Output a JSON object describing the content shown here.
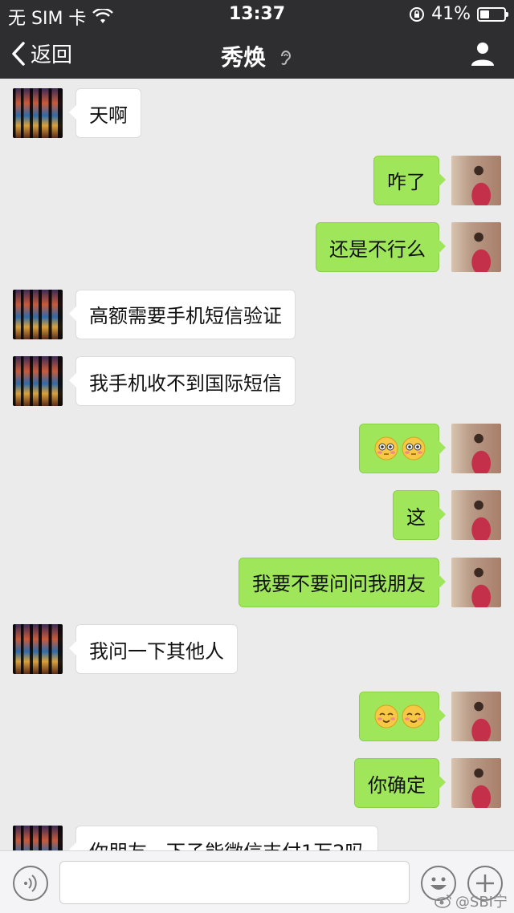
{
  "status_bar": {
    "carrier": "无 SIM 卡",
    "time": "13:37",
    "battery": "41%",
    "battery_level": 0.41
  },
  "nav": {
    "back_label": "返回",
    "title": "秀焕"
  },
  "messages": [
    {
      "side": "left",
      "text": "天啊"
    },
    {
      "side": "right",
      "text": "咋了"
    },
    {
      "side": "right",
      "text": "还是不行么"
    },
    {
      "side": "left",
      "text": "高额需要手机短信验证"
    },
    {
      "side": "left",
      "text": "我手机收不到国际短信"
    },
    {
      "side": "right",
      "text": "",
      "emoji": [
        "flushed-face",
        "flushed-face"
      ]
    },
    {
      "side": "right",
      "text": "这"
    },
    {
      "side": "right",
      "text": "我要不要问问我朋友"
    },
    {
      "side": "left",
      "text": "我问一下其他人"
    },
    {
      "side": "right",
      "text": "",
      "emoji": [
        "smiling-blush-face",
        "smiling-blush-face"
      ]
    },
    {
      "side": "right",
      "text": "你确定"
    },
    {
      "side": "left",
      "text": "你朋友一下子能微信支付1万2吗"
    }
  ],
  "input": {
    "value": "",
    "placeholder": ""
  },
  "watermark": "@SBI宁",
  "colors": {
    "header_bg": "#2e2e30",
    "chat_bg": "#ebebeb",
    "self_bubble": "#9fe65a",
    "friend_bubble": "#ffffff"
  }
}
